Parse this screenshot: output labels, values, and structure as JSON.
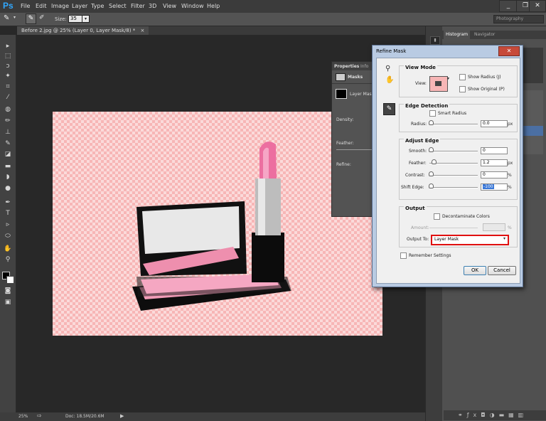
{
  "app": {
    "logo": "Ps"
  },
  "menu": [
    "File",
    "Edit",
    "Image",
    "Layer",
    "Type",
    "Select",
    "Filter",
    "3D",
    "View",
    "Window",
    "Help"
  ],
  "options": {
    "size_label": "Size:",
    "size_value": "35",
    "workspace": "Photography"
  },
  "document": {
    "tab_title": "Before 2.jpg @ 25% (Layer 0, Layer Mask/8) *",
    "close_symbol": "×"
  },
  "status": {
    "zoom": "25%",
    "doc_info": "Doc: 18.5M/20.6M"
  },
  "panels": {
    "histogram_tab": "Histogram",
    "navigator_tab": "Navigator"
  },
  "properties": {
    "tab1": "Properties",
    "tab2": "Info",
    "masks_label": "Masks",
    "layer_mask_label": "Layer Mask",
    "density_label": "Density:",
    "feather_label": "Feather:",
    "refine_label": "Refine:"
  },
  "dialog": {
    "title": "Refine Mask",
    "view_mode": {
      "heading": "View Mode",
      "view_label": "View:",
      "show_radius": "Show Radius (J)",
      "show_original": "Show Original (P)"
    },
    "edge_detection": {
      "heading": "Edge Detection",
      "smart_radius": "Smart Radius",
      "radius_label": "Radius:",
      "radius_value": "0.0",
      "radius_unit": "px"
    },
    "adjust_edge": {
      "heading": "Adjust Edge",
      "smooth_label": "Smooth:",
      "smooth_value": "0",
      "feather_label": "Feather:",
      "feather_value": "1.2",
      "feather_unit": "px",
      "contrast_label": "Contrast:",
      "contrast_value": "0",
      "contrast_unit": "%",
      "shift_label": "Shift Edge:",
      "shift_value": "-100",
      "shift_unit": "%"
    },
    "output": {
      "heading": "Output",
      "decontaminate": "Decontaminate Colors",
      "amount_label": "Amount:",
      "amount_unit": "%",
      "output_to_label": "Output To:",
      "output_to_value": "Layer Mask"
    },
    "remember": "Remember Settings",
    "ok": "OK",
    "cancel": "Cancel"
  },
  "colors": {
    "accent_red": "#e01010",
    "ps_blue": "#31a8ff",
    "dialog_frame": "#b9cbe3"
  }
}
